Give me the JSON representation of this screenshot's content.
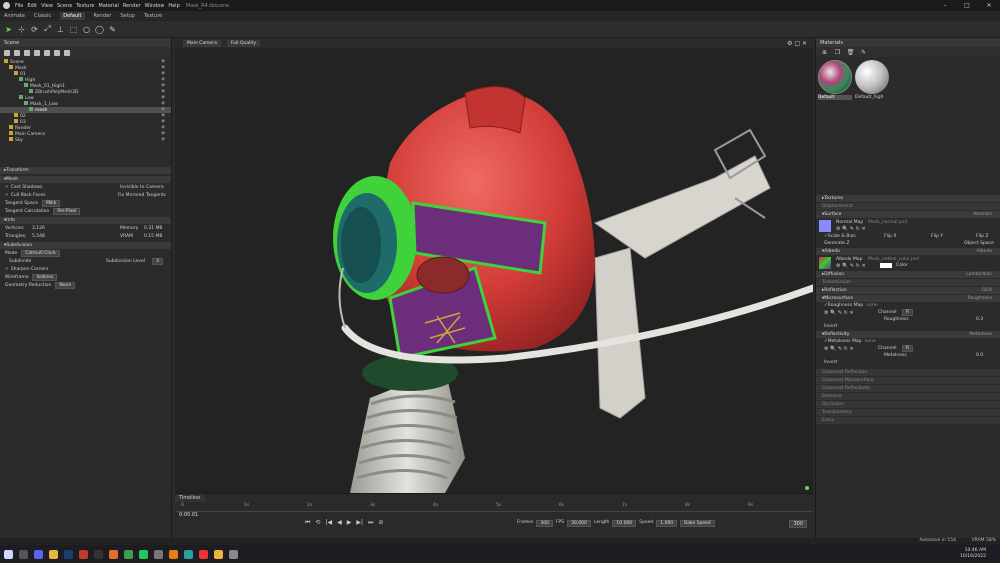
{
  "app": {
    "title": "Mask_R4.tbscene"
  },
  "menu": [
    "File",
    "Edit",
    "View",
    "Scene",
    "Texture",
    "Material",
    "Render",
    "Window",
    "Help"
  ],
  "tabs": [
    "Animate",
    "Classic",
    "Default",
    "Render",
    "Setup",
    "Texture"
  ],
  "active_tab": "Default",
  "scene": {
    "title": "Scene",
    "tree": [
      {
        "label": "Scene",
        "indent": 0
      },
      {
        "label": "Mask",
        "indent": 1
      },
      {
        "label": "01",
        "indent": 2
      },
      {
        "label": "High",
        "indent": 3
      },
      {
        "label": "Mask_01_High1",
        "indent": 4
      },
      {
        "label": "ZBrushPolyMesh3D",
        "indent": 5
      },
      {
        "label": "Low",
        "indent": 3
      },
      {
        "label": "Mask_1_Low",
        "indent": 4
      },
      {
        "label": "mesh",
        "indent": 5,
        "selected": true
      },
      {
        "label": "02",
        "indent": 2
      },
      {
        "label": "03",
        "indent": 2
      },
      {
        "label": "Render",
        "indent": 1
      },
      {
        "label": "Main Camera",
        "indent": 1
      },
      {
        "label": "Sky",
        "indent": 1
      }
    ]
  },
  "properties": {
    "transform": "Transform",
    "mesh": "Mesh",
    "cast_shadows": "Cast Shadows",
    "invisible_to_camera": "Invisible to Camera",
    "cull_back_faces": "Cull Back Faces",
    "fix_mirrored": "Fix Mirrored Tangents",
    "tangent_space_label": "Tangent Space",
    "tangent_space": "Mikk",
    "tangent_calc_label": "Tangent Calculation",
    "tangent_calc": "Per-Pixel",
    "info": "Info",
    "vertices_label": "Vertices",
    "vertices": "3,126",
    "triangles_label": "Triangles",
    "triangles": "5,548",
    "memory_label": "Memory",
    "memory": "0.31 MB",
    "vram_label": "VRAM",
    "vram": "0.15 MB",
    "subdivision": "Subdivision",
    "mode_label": "Mode",
    "mode": "Catmull-Clark",
    "subdivide": "Subdivide",
    "sub_level_label": "Subdivision Level",
    "sub_level": "3",
    "sharpen": "Sharpen Corners",
    "wireframe_label": "Wireframe",
    "wireframe": "Isolines",
    "geo_reduction_label": "Geometry Reduction",
    "geo_reduction": "None"
  },
  "viewport": {
    "camera": "Main Camera",
    "quality": "Full Quality"
  },
  "timeline": {
    "title": "Timeline",
    "ticks": [
      "0",
      "1s",
      "2s",
      "3s",
      "4s",
      "5s",
      "6s",
      "7s",
      "8s",
      "9s"
    ],
    "time": "0:00.01",
    "frames_label": "Frames",
    "frames": "300",
    "fps_label": "FPS",
    "fps": "30.000",
    "length_label": "Length",
    "length": "10.000",
    "speed_label": "Speed",
    "speed": "1.000",
    "bake_speed": "Bake Speed",
    "end_frame": "300"
  },
  "materials": {
    "title": "Materials",
    "items": [
      "Default",
      "Default_high"
    ],
    "selected": "Default",
    "sections": [
      {
        "label": "Textures",
        "value": ""
      },
      {
        "label": "Displacement",
        "value": "",
        "dim": true
      },
      {
        "label": "Surface",
        "value": "Normals"
      }
    ],
    "normal_map": "Normal Map",
    "normal_file": "Mask_normal.psd",
    "scale_bias": "Scale & Bias",
    "flip_x": "Flip X",
    "flip_y": "Flip Y",
    "flip_z": "Flip Z",
    "generate_z": "Generate Z",
    "object_space": "Object Space",
    "albedo": "Albedo",
    "albedo_val": "Albedo",
    "albedo_map": "Albedo Map",
    "albedo_file": "Mask_netteo_color.psd",
    "color": "Color",
    "diffusion": "Diffusion",
    "diffusion_val": "Lambertian",
    "transmission": "Transmission",
    "reflection": "Reflection",
    "reflection_val": "GGX",
    "microsurface": "Microsurface",
    "microsurface_val": "Roughness",
    "roughness_map": "Roughness Map",
    "roughness_file": "none",
    "channel_label": "Channel",
    "channel": "R",
    "roughness": "Roughness",
    "roughness_val": "0.3",
    "invert": "Invert",
    "reflectivity": "Reflectivity",
    "reflectivity_val": "Metalness",
    "metalness_map": "Metalness Map",
    "metalness_file": "none",
    "metalness": "Metalness",
    "metalness_val": "0.0",
    "extra_sections": [
      "Clearcoat Reflection",
      "Clearcoat Microsurface",
      "Clearcoat Reflectivity",
      "Emissive",
      "Occlusion",
      "Transparency",
      "Extra"
    ]
  },
  "status": {
    "autosave": "Autosave in 154",
    "vram": "VRAM 58%",
    "clock": "10:46 AM",
    "date": "10/16/2022"
  },
  "colors": {
    "mask_red": "#d8433f",
    "green_trim": "#3fd23a",
    "purple_strap": "#6c2d7a",
    "hose": "#d9d7d2",
    "viewport_bg": "#232323"
  }
}
